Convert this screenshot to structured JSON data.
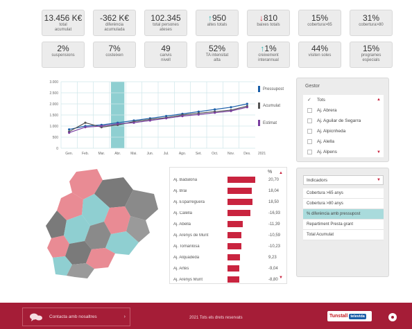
{
  "kpis_row1": [
    {
      "value": "13.456 K€",
      "label": "total\nacumulat"
    },
    {
      "value": "-362 K€",
      "label": "diferència\nacumulada"
    },
    {
      "value": "102.345",
      "label": "total persones\nateses"
    },
    {
      "value": "950",
      "label": "altes totals",
      "arrow": "up"
    },
    {
      "value": "810",
      "label": "baixes totals",
      "arrow": "down"
    },
    {
      "value": "15%",
      "label": "cobertura>65"
    },
    {
      "value": "31%",
      "label": "cobertura>80"
    }
  ],
  "kpis_row2": [
    {
      "value": "2%",
      "label": "suspensions"
    },
    {
      "value": "7%",
      "label": "costeixen"
    },
    {
      "value": "49",
      "label": "canvis\nnivell"
    },
    {
      "value": "52%",
      "label": "TA intensitat\nalta"
    },
    {
      "value": "1%",
      "label": "creixement\ninterannual",
      "arrow": "up"
    },
    {
      "value": "44%",
      "label": "visiten soles"
    },
    {
      "value": "15%",
      "label": "programes\nespecials"
    }
  ],
  "chart_data": {
    "type": "line",
    "categories": [
      "Gen.",
      "Feb.",
      "Mar.",
      "Abr.",
      "Mai.",
      "Jun.",
      "Jul.",
      "Ago.",
      "Set.",
      "Oct.",
      "Nov.",
      "Des."
    ],
    "year_label": "2021",
    "y_ticks": [
      "0",
      "500",
      "1.000",
      "1.500",
      "2.000",
      "2.500",
      "3.000"
    ],
    "ylim": [
      0,
      3000
    ],
    "highlight_category": "Abr.",
    "series": [
      {
        "name": "Pressupost",
        "color": "#1a5ea8",
        "values": [
          850,
          1000,
          1050,
          1150,
          1250,
          1350,
          1450,
          1550,
          1650,
          1750,
          1850,
          2000
        ]
      },
      {
        "name": "Acumulat",
        "color": "#555555",
        "values": [
          750,
          1150,
          950,
          1050,
          1200,
          1300,
          1380,
          1500,
          1580,
          1650,
          1720,
          1900
        ]
      },
      {
        "name": "Estimat",
        "color": "#7a3fa0",
        "values": [
          700,
          950,
          1000,
          1100,
          1150,
          1250,
          1350,
          1450,
          1520,
          1600,
          1680,
          1850
        ]
      }
    ],
    "grid": true,
    "legend": "right"
  },
  "filter": {
    "title": "Gestor",
    "items": [
      {
        "label": "Tots",
        "checked": true
      },
      {
        "label": "Aj. Abrera",
        "checked": false
      },
      {
        "label": "Aj. Aguilar de Segarra",
        "checked": false
      },
      {
        "label": "Aj. Alpicnheda",
        "checked": false
      },
      {
        "label": "Aj. Alella",
        "checked": false
      },
      {
        "label": "Aj. Alpens",
        "checked": false
      }
    ]
  },
  "ranking": {
    "header": "%",
    "rows": [
      {
        "name": "Aj. Badalona",
        "value": "20,70",
        "num": 20.7
      },
      {
        "name": "Aj. Brai",
        "value": "18,04",
        "num": 18.04
      },
      {
        "name": "Aj. Esparreguera",
        "value": "18,50",
        "num": 18.5
      },
      {
        "name": "Aj. Calella",
        "value": "-16,93",
        "num": 16.93
      },
      {
        "name": "Aj. Abella",
        "value": "-11,39",
        "num": 11.39
      },
      {
        "name": "Aj. Arenys de Munt",
        "value": "-10,59",
        "num": 10.59
      },
      {
        "name": "Aj. Tomanlosa",
        "value": "-10,23",
        "num": 10.23
      },
      {
        "name": "Aj. Alquadeda",
        "value": "9,23",
        "num": 9.23
      },
      {
        "name": "Aj. Artés",
        "value": "-9,04",
        "num": 9.04
      },
      {
        "name": "Aj. Arenys Munt",
        "value": "-8,80",
        "num": 8.8
      }
    ]
  },
  "indicators": {
    "selected": "Indicadors",
    "items": [
      {
        "label": "Cobertura >65 anys",
        "active": false
      },
      {
        "label": "Cobertura >80 anys",
        "active": false
      },
      {
        "label": "% diferència amb pressupost",
        "active": true
      },
      {
        "label": "Repartiment Presta grant",
        "active": false
      },
      {
        "label": "Total Acumulat",
        "active": false
      }
    ]
  },
  "footer": {
    "contact": "Contacta amb nosaltres",
    "copyright": "2021 Tots els drets reservats",
    "brand_main": "Tunstall",
    "brand_sub": "televida"
  },
  "colors": {
    "accent_red": "#a51d37",
    "teal": "#a9dbdc",
    "map_pink": "#e98b94",
    "map_teal": "#8fcfd1",
    "map_gray": "#7a7a7a"
  }
}
